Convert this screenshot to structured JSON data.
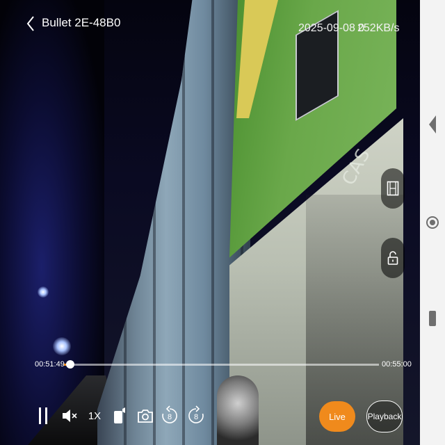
{
  "header": {
    "device_name": "Bullet 2E-48B0",
    "datetime": "2025-09-08 0",
    "bitrate": "252KB/s"
  },
  "video_overlay": {
    "watermark_text": "CAS"
  },
  "timeline": {
    "start_time": "00:51:49",
    "end_time": "00:55:00",
    "progress": 0.02
  },
  "controls": {
    "speed_label": "1X",
    "skip_back_seconds": "8",
    "skip_forward_seconds": "8",
    "live_label": "Live",
    "playback_label": "Playback"
  },
  "colors": {
    "accent": "#f08a1c",
    "nav_bar": "#f3f3f3",
    "nav_icon": "#6e6e6e"
  },
  "icons": {
    "back": "chevron-left-icon",
    "pause": "pause-icon",
    "mute": "speaker-muted-icon",
    "record": "video-record-icon",
    "snapshot": "camera-icon",
    "skip_back": "rewind-8-icon",
    "skip_forward": "forward-8-icon",
    "clip": "film-strip-icon",
    "lock": "unlock-icon"
  }
}
